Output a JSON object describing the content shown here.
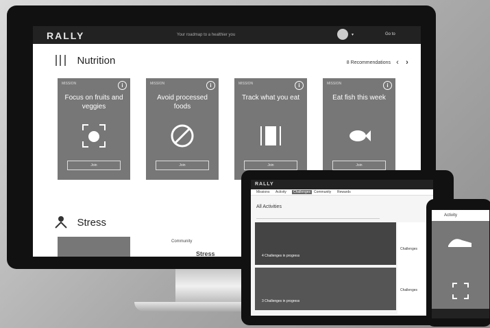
{
  "desktop": {
    "logo": "RALLY",
    "tagline": "Your roadmap to a healthier you",
    "user_menu": "Go to",
    "section_nutrition": "Nutrition",
    "recommendations": "8 Recommendations",
    "cards": [
      {
        "label": "Mission",
        "title": "Focus on fruits and veggies",
        "join": "Join"
      },
      {
        "label": "Mission",
        "title": "Avoid processed foods",
        "join": "Join"
      },
      {
        "label": "Mission",
        "title": "Track what you eat",
        "join": "Join"
      },
      {
        "label": "Mission",
        "title": "Eat fish this week",
        "join": "Join"
      }
    ],
    "section_stress": "Stress",
    "stress_card_label": "Community",
    "stress_card_title": "Stress"
  },
  "tablet": {
    "logo": "RALLY",
    "nav_tabs": [
      "Missions",
      "Activity",
      "Challenges",
      "Community",
      "Rewards"
    ],
    "heading": "All Activities",
    "side_label_1": "Challenges",
    "side_label_2": "Challenges",
    "hero_1": "4 Challenges in progress",
    "hero_2": "3 Challenges in progress"
  },
  "phone": {
    "title": "Activity"
  },
  "colors": {
    "card_bg": "#777777",
    "bezel": "#111111",
    "topbar": "#222222"
  }
}
